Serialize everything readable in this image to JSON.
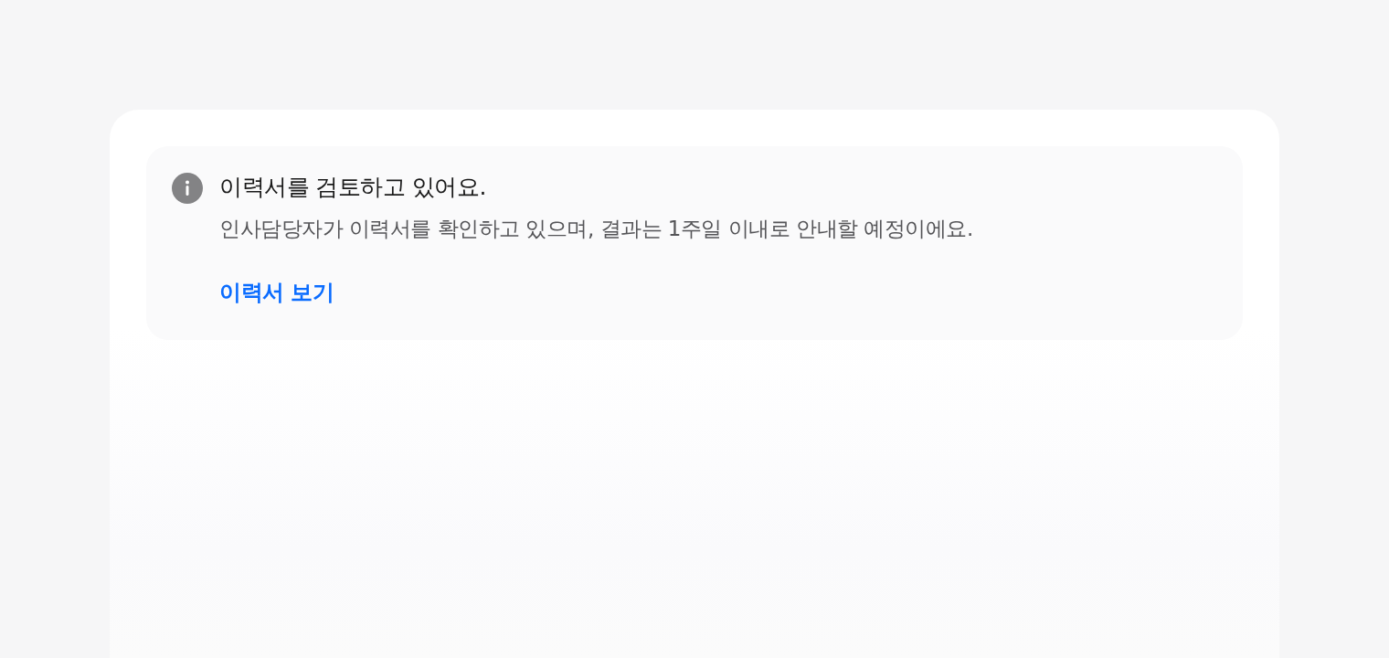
{
  "notice": {
    "title": "이력서를 검토하고 있어요.",
    "description": "인사담당자가 이력서를 확인하고 있으며, 결과는 1주일 이내로 안내할 예정이에요.",
    "link": "이력서 보기"
  }
}
